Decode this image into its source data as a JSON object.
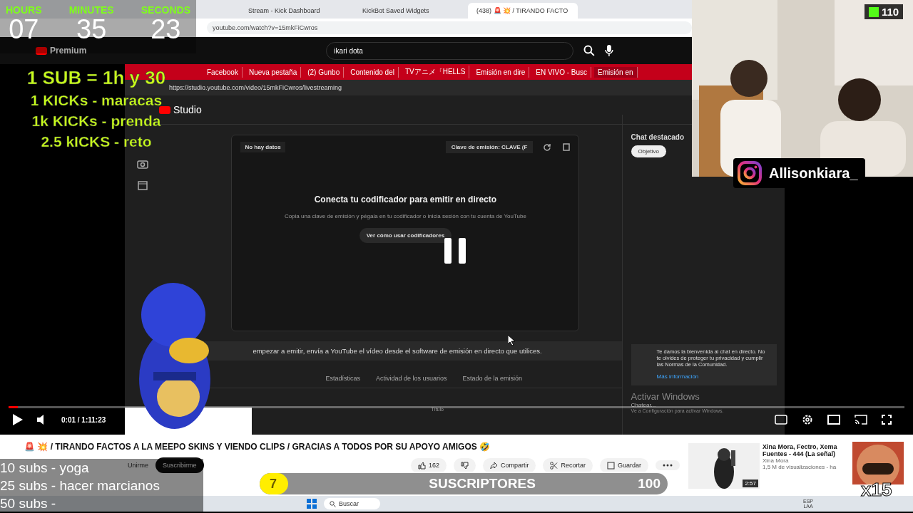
{
  "browser": {
    "tabs": [
      {
        "title": "Stream - Kick Dashboard",
        "selected": false
      },
      {
        "title": "KickBot Saved Widgets",
        "selected": false
      },
      {
        "title": "(438) 🚨 💥 / TIRANDO FACTO",
        "selected": true
      }
    ],
    "address": "youtube.com/watch?v=15mkFiCwros"
  },
  "youtube": {
    "logo": "Premium",
    "search": "ikari dota"
  },
  "studio": {
    "tabs": [
      {
        "title": "Facebook",
        "selected": false
      },
      {
        "title": "Nueva pestaña",
        "selected": false
      },
      {
        "title": "(2) Gunbo",
        "selected": false
      },
      {
        "title": "Contenido del",
        "selected": false
      },
      {
        "title": "TVアニメ「HELLS",
        "selected": false
      },
      {
        "title": "Emisión en dire",
        "selected": false
      },
      {
        "title": "EN VIVO - Busc",
        "selected": false
      },
      {
        "title": "Emisión en",
        "selected": true
      }
    ],
    "address": "https://studio.youtube.com/video/15mkFiCwros/livestreaming",
    "logo": "Studio",
    "status": "No hay datos",
    "stream_key": "Clave de emisión: CLAVE (F",
    "heading": "Conecta tu codificador para emitir en directo",
    "description": "Copia una clave de emisión y pégala en tu codificador o inicia sesión con tu cuenta de YouTube",
    "help_button": "Ver cómo usar codificadores",
    "hint": "empezar a emitir, envía a YouTube el vídeo desde el software de emisión en directo que utilices.",
    "bottom_tabs": [
      {
        "label": "Estadísticas",
        "selected": false
      },
      {
        "label": "Actividad de los usuarios",
        "selected": false
      },
      {
        "label": "Estado de la emisión",
        "selected": false
      }
    ],
    "field_label": "Título",
    "chat": {
      "title": "Chat destacado",
      "goal_button": "Objetivo",
      "notice": "Te damos la bienvenida al chat en directo. No te olvides de proteger tu privacidad y cumplir las Normas de la Comunidad.",
      "link": "Más información",
      "placeholder": "Chatear...",
      "activation": "Activar Windows",
      "activation_hint": "Ve a Configuración para activar Windows."
    }
  },
  "player": {
    "level": 0.01,
    "time": "0:01 / 1:11:23"
  },
  "video_info": {
    "title": "🚨 💥 / TIRANDO FACTOS A LA MEEPO SKINS Y VIENDO CLIPS / GRACIAS A TODOS POR SU APOYO AMIGOS 🤣",
    "join": "Unirme",
    "subscribe": "Suscribirme",
    "likes": "162",
    "share": "Compartir",
    "clip": "Recortar",
    "save": "Guardar"
  },
  "recommendation": {
    "title_lines": [
      "Xina Mora, Fectro, Xema",
      "Fuentes - 444 (La señal)"
    ],
    "channel": "Xina Mora",
    "views": "1,5 M de visualizaciones - ha",
    "duration": "2:57"
  },
  "taskbar": {
    "search": "Buscar",
    "language": [
      "ESP",
      "LAA"
    ]
  },
  "overlay": {
    "timer": [
      {
        "label": "HOURS",
        "value": "07"
      },
      {
        "label": "MINUTES",
        "value": "35"
      },
      {
        "label": "SECONDS",
        "value": "23"
      }
    ],
    "rules": [
      "1 SUB = 1h y 30",
      "1 KICKs - maracas",
      "1k KICKs - prenda",
      "2.5 kICKS - reto"
    ],
    "kick_count": "110",
    "instagram": "Allisonkiara_",
    "sub_goals": [
      "10 subs - yoga",
      "25 subs - hacer marcianos",
      "50 subs -"
    ],
    "goal": {
      "current": "7",
      "label": "SUSCRIPTORES",
      "target": "100",
      "level": 0.07
    },
    "multiplier": "x15"
  }
}
